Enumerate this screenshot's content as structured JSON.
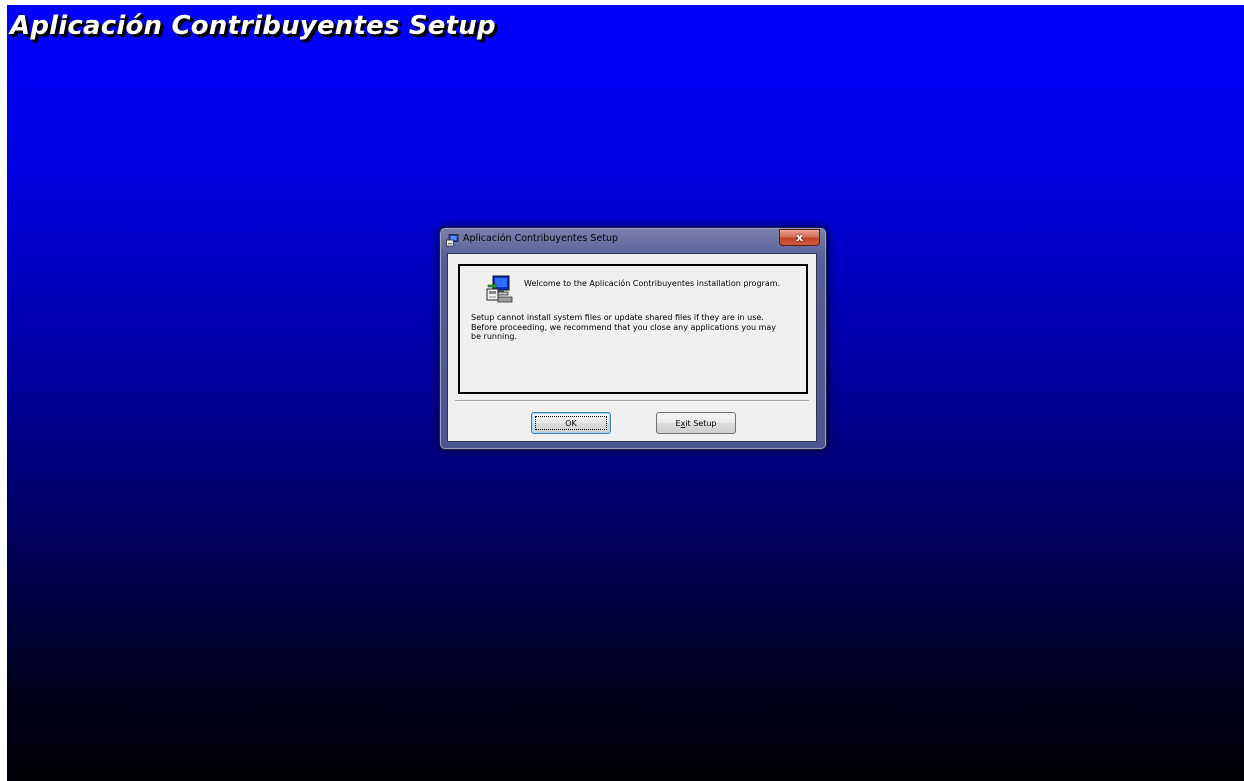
{
  "screen": {
    "banner_title": "Aplicación Contribuyentes Setup",
    "background_top": "#0000ff",
    "background_bottom": "#000008"
  },
  "dialog": {
    "title": "Aplicación Contribuyentes Setup",
    "title_icon": "setup-icon",
    "close_label": "x",
    "welcome": "Welcome to the Aplicación Contribuyentes installation program.",
    "warning_lines": [
      "Setup cannot install system files or update shared files if they are in use.",
      "Before proceeding, we recommend that you close any applications you may",
      "be running."
    ],
    "buttons": {
      "ok": "OK",
      "exit_prefix": "E",
      "exit_accel": "x",
      "exit_suffix": "it Setup"
    }
  }
}
